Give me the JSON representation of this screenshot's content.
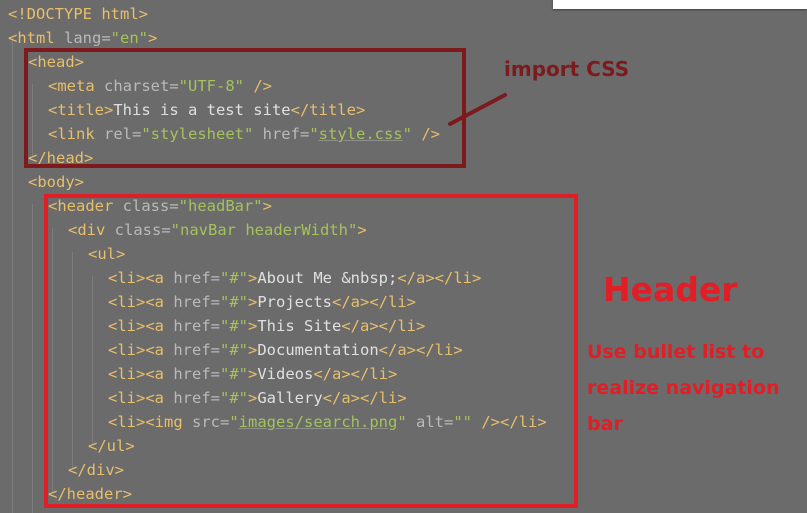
{
  "code_lines": [
    [
      {
        "c": "tag",
        "t": "<!DOCTYPE html>"
      }
    ],
    [
      {
        "c": "tag",
        "t": "<html "
      },
      {
        "c": "attr",
        "t": "lang="
      },
      {
        "c": "str",
        "t": "\"en\""
      },
      {
        "c": "tag",
        "t": ">"
      }
    ],
    [
      {
        "c": "tag",
        "t": "<head>"
      }
    ],
    [
      {
        "c": "tag",
        "t": "<meta "
      },
      {
        "c": "attr",
        "t": "charset="
      },
      {
        "c": "str",
        "t": "\"UTF-8\""
      },
      {
        "c": "tag",
        "t": " />"
      }
    ],
    [
      {
        "c": "tag",
        "t": "<title>"
      },
      {
        "c": "txt",
        "t": "This is a test site"
      },
      {
        "c": "tag",
        "t": "</title>"
      }
    ],
    [
      {
        "c": "tag",
        "t": "<link "
      },
      {
        "c": "attr",
        "t": "rel="
      },
      {
        "c": "str",
        "t": "\"stylesheet\""
      },
      {
        "c": "attr",
        "t": " href="
      },
      {
        "c": "str",
        "t": "\""
      },
      {
        "c": "url",
        "t": "style.css"
      },
      {
        "c": "str",
        "t": "\""
      },
      {
        "c": "tag",
        "t": " />"
      }
    ],
    [
      {
        "c": "tag",
        "t": "</head>"
      }
    ],
    [
      {
        "c": "tag",
        "t": "<body>"
      }
    ],
    [
      {
        "c": "tag",
        "t": "<header "
      },
      {
        "c": "attr",
        "t": "class="
      },
      {
        "c": "str",
        "t": "\"headBar\""
      },
      {
        "c": "tag",
        "t": ">"
      }
    ],
    [
      {
        "c": "tag",
        "t": "<div "
      },
      {
        "c": "attr",
        "t": "class="
      },
      {
        "c": "str",
        "t": "\"navBar headerWidth\""
      },
      {
        "c": "tag",
        "t": ">"
      }
    ],
    [
      {
        "c": "tag",
        "t": "<ul>"
      }
    ],
    [
      {
        "c": "tag",
        "t": "<li><a "
      },
      {
        "c": "attr",
        "t": "href="
      },
      {
        "c": "str",
        "t": "\"#\""
      },
      {
        "c": "tag",
        "t": ">"
      },
      {
        "c": "txt",
        "t": "About Me &nbsp;"
      },
      {
        "c": "tag",
        "t": "</a></li>"
      }
    ],
    [
      {
        "c": "tag",
        "t": "<li><a "
      },
      {
        "c": "attr",
        "t": "href="
      },
      {
        "c": "str",
        "t": "\"#\""
      },
      {
        "c": "tag",
        "t": ">"
      },
      {
        "c": "txt",
        "t": "Projects"
      },
      {
        "c": "tag",
        "t": "</a></li>"
      }
    ],
    [
      {
        "c": "tag",
        "t": "<li><a "
      },
      {
        "c": "attr",
        "t": "href="
      },
      {
        "c": "str",
        "t": "\"#\""
      },
      {
        "c": "tag",
        "t": ">"
      },
      {
        "c": "txt",
        "t": "This Site"
      },
      {
        "c": "tag",
        "t": "</a></li>"
      }
    ],
    [
      {
        "c": "tag",
        "t": "<li><a "
      },
      {
        "c": "attr",
        "t": "href="
      },
      {
        "c": "str",
        "t": "\"#\""
      },
      {
        "c": "tag",
        "t": ">"
      },
      {
        "c": "txt",
        "t": "Documentation"
      },
      {
        "c": "tag",
        "t": "</a></li>"
      }
    ],
    [
      {
        "c": "tag",
        "t": "<li><a "
      },
      {
        "c": "attr",
        "t": "href="
      },
      {
        "c": "str",
        "t": "\"#\""
      },
      {
        "c": "tag",
        "t": ">"
      },
      {
        "c": "txt",
        "t": "Videos"
      },
      {
        "c": "tag",
        "t": "</a></li>"
      }
    ],
    [
      {
        "c": "tag",
        "t": "<li><a "
      },
      {
        "c": "attr",
        "t": "href="
      },
      {
        "c": "str",
        "t": "\"#\""
      },
      {
        "c": "tag",
        "t": ">"
      },
      {
        "c": "txt",
        "t": "Gallery"
      },
      {
        "c": "tag",
        "t": "</a></li>"
      }
    ],
    [
      {
        "c": "tag",
        "t": "<li><img "
      },
      {
        "c": "attr",
        "t": "src="
      },
      {
        "c": "str",
        "t": "\""
      },
      {
        "c": "url",
        "t": "images/search.png"
      },
      {
        "c": "str",
        "t": "\""
      },
      {
        "c": "attr",
        "t": " alt="
      },
      {
        "c": "str",
        "t": "\"\""
      },
      {
        "c": "tag",
        "t": " /></li>"
      }
    ],
    [
      {
        "c": "tag",
        "t": "</ul>"
      }
    ],
    [
      {
        "c": "tag",
        "t": "</div>"
      }
    ],
    [
      {
        "c": "tag",
        "t": "</header>"
      }
    ]
  ],
  "annotations": {
    "import_css": "import CSS",
    "header": "Header",
    "description": "Use bullet list to realize navigation bar"
  },
  "colors": {
    "editor_bg": "#6b6b6b",
    "tag": "#e8bf6a",
    "attribute": "#bababa",
    "string": "#a5c25c",
    "head_box": "#7c1a1e",
    "header_box": "#e11d25"
  }
}
